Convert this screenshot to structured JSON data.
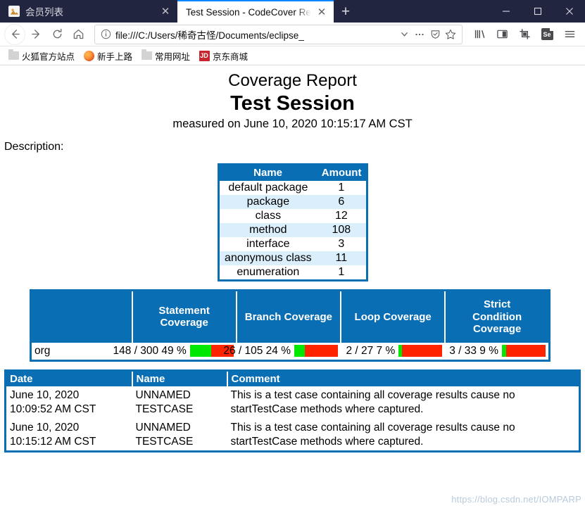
{
  "window": {
    "controls": {
      "minimize": "minimize-icon",
      "maximize": "maximize-icon",
      "close": "close-icon"
    }
  },
  "tabs": [
    {
      "title": "会员列表",
      "favicon": "image-icon",
      "active": false,
      "close_label": "✕"
    },
    {
      "title": "Test Session - CodeCover Report",
      "favicon": "page-icon",
      "active": true,
      "close_label": "✕"
    }
  ],
  "newtab_label": "+",
  "nav": {
    "back": "back-arrow",
    "forward": "forward-arrow",
    "reload": "reload-arrow",
    "home": "home-icon"
  },
  "urlbar": {
    "url": "file:///C:/Users/稀奇古怪/Documents/eclipse_",
    "identity_icon": "info-circle-icon",
    "dropdown_icon": "chevron-down-icon",
    "page_actions_icon": "ellipsis-icon",
    "reader_icon": "shield-icon",
    "bookmark_icon": "star-icon"
  },
  "toolbar_icons": [
    {
      "name": "library-icon",
      "glyph": "library"
    },
    {
      "name": "sidebar-icon",
      "glyph": "sidebar"
    },
    {
      "name": "screenshot-icon",
      "glyph": "crop"
    },
    {
      "name": "selenium-ide-icon",
      "glyph": "Se"
    },
    {
      "name": "menu-icon",
      "glyph": "hamburger"
    }
  ],
  "bookmarks": [
    {
      "label": "火狐官方站点",
      "icon": "folder-icon"
    },
    {
      "label": "新手上路",
      "icon": "firefox-icon"
    },
    {
      "label": "常用网址",
      "icon": "folder-icon"
    },
    {
      "label": "京东商城",
      "icon": "jd-icon"
    }
  ],
  "report": {
    "title": "Coverage Report",
    "session": "Test Session",
    "measured": "measured on June 10, 2020 10:15:17 AM CST",
    "description_label": "Description:"
  },
  "summary_table": {
    "headers": [
      "Name",
      "Amount"
    ],
    "rows": [
      {
        "name": "default package",
        "amount": "1"
      },
      {
        "name": "package",
        "amount": "6"
      },
      {
        "name": "class",
        "amount": "12"
      },
      {
        "name": "method",
        "amount": "108"
      },
      {
        "name": "interface",
        "amount": "3"
      },
      {
        "name": "anonymous class",
        "amount": "11"
      },
      {
        "name": "enumeration",
        "amount": "1"
      }
    ]
  },
  "coverage_table": {
    "headers": [
      "",
      "Statement Coverage",
      "Branch Coverage",
      "Loop Coverage",
      "Strict Condition Coverage"
    ],
    "header_lines": [
      [
        ""
      ],
      [
        "Statement",
        "Coverage"
      ],
      [
        "Branch Coverage"
      ],
      [
        "Loop Coverage"
      ],
      [
        "Strict",
        "Condition",
        "Coverage"
      ]
    ],
    "row_name": "org",
    "metrics": [
      {
        "label": "Statement Coverage",
        "text": "148 / 300 49 %",
        "covered": 148,
        "total": 300,
        "percent": 49
      },
      {
        "label": "Branch Coverage",
        "text": "26 / 105 24 %",
        "covered": 26,
        "total": 105,
        "percent": 24
      },
      {
        "label": "Loop Coverage",
        "text": "2 / 27 7 %",
        "covered": 2,
        "total": 27,
        "percent": 7
      },
      {
        "label": "Strict Condition Coverage",
        "text": "3 / 33 9 %",
        "covered": 3,
        "total": 33,
        "percent": 9
      }
    ]
  },
  "testcase_table": {
    "headers": [
      "Date",
      "Name",
      "Comment"
    ],
    "rows": [
      {
        "date": "June 10, 2020\n10:09:52 AM CST",
        "name": "UNNAMED\nTESTCASE",
        "comment": "This is a test case containing all coverage results cause no startTestCase methods where captured."
      },
      {
        "date": "June 10, 2020\n10:15:12 AM CST",
        "name": "UNNAMED\nTESTCASE",
        "comment": "This is a test case containing all coverage results cause no startTestCase methods where captured."
      }
    ]
  },
  "watermark": "https://blog.csdn.net/IOMPARP",
  "colors": {
    "table_blue": "#0a6eb4",
    "row_alt": "#daeefb",
    "bar_green": "#00e800",
    "bar_red": "#ff2400",
    "titlebar": "#21253f"
  }
}
